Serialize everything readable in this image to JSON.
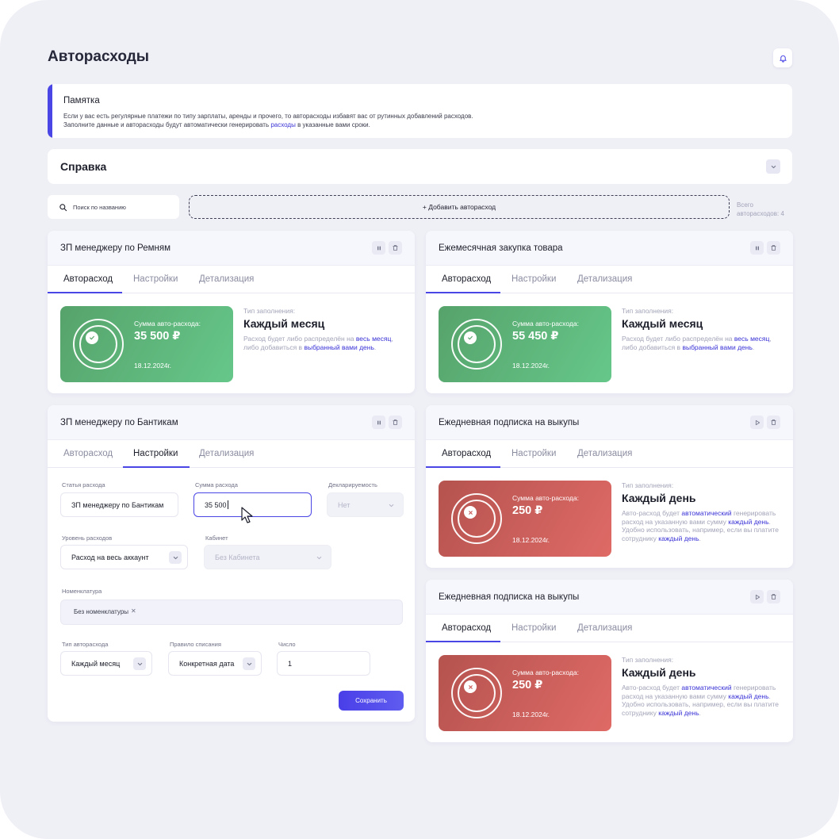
{
  "page": {
    "title": "Авторасходы"
  },
  "memo": {
    "title": "Памятка",
    "text_1": "Если у вас есть регулярные платежи по типу зарплаты, аренды и прочего, то авторасходы избавят вас от рутинных добавлений расходов. Заполните данные и авторасходы будут автоматически генерировать ",
    "link": "расходы",
    "text_2": " в указанные вами сроки."
  },
  "help": {
    "title": "Справка"
  },
  "search": {
    "placeholder": "Поиск по названию"
  },
  "add_button": "+ Добавить авторасход",
  "total": {
    "line_1": "Всего",
    "line_2": "авторасходов: 4"
  },
  "tabs": [
    "Авторасход",
    "Настройки",
    "Детализация"
  ],
  "cards": [
    {
      "title": "ЗП менеджеру по Ремням",
      "sum_label": "Сумма авто-расхода:",
      "sum_value": "35 500 ₽",
      "date": "18.12.2024г.",
      "fill_label": "Тип заполнения:",
      "fill_type": "Каждый месяц",
      "desc_1": "Расход будет либо распределён на ",
      "desc_link_1": "весь месяц",
      "desc_2": ", либо добавиться в ",
      "desc_link_2": "выбранный вами день",
      "desc_3": "."
    },
    {
      "title": "Ежемесячная закупка товара",
      "sum_label": "Сумма авто-расхода:",
      "sum_value": "55 450 ₽",
      "date": "18.12.2024г.",
      "fill_label": "Тип заполнения:",
      "fill_type": "Каждый месяц",
      "desc_1": "Расход будет либо распределён на ",
      "desc_link_1": "весь месяц",
      "desc_2": ", либо добавиться в ",
      "desc_link_2": "выбранный вами день",
      "desc_3": "."
    },
    {
      "title": "ЗП менеджеру по Бантикам",
      "form": {
        "article_label": "Статья расхода",
        "article_value": "ЗП менеджеру по Бантикам",
        "sum_label": "Сумма расхода",
        "sum_value": "35 500",
        "declared_label": "Декларируемость",
        "declared_value": "Нет",
        "level_label": "Уровень расходов",
        "level_value": "Расход на весь аккаунт",
        "cabinet_label": "Кабинет",
        "cabinet_value": "Без Кабинета",
        "nomenclature_label": "Номенклатура",
        "nomenclature_chip": "Без номенклатуры",
        "type_label": "Тип авторасхода",
        "type_value": "Каждый месяц",
        "rule_label": "Правило списания",
        "rule_value": "Конкретная дата",
        "number_label": "Число",
        "number_value": "1",
        "save": "Сохранить"
      }
    },
    {
      "title": "Ежедневная подписка на выкупы",
      "sum_label": "Сумма авто-расхода:",
      "sum_value": "250 ₽",
      "date": "18.12.2024г.",
      "fill_label": "Тип заполнения:",
      "fill_type": "Каждый день",
      "desc_1": "Авто-расход будет ",
      "desc_link_1": "автоматический",
      "desc_2": " генерировать расход на указанную вами сумму ",
      "desc_link_2": "каждый день",
      "desc_3": ". Удобно использовать, например, если вы платите сотруднику ",
      "desc_link_3": "каждый день",
      "desc_4": "."
    },
    {
      "title": "Ежедневная подписка на выкупы",
      "sum_label": "Сумма авто-расхода:",
      "sum_value": "250 ₽",
      "date": "18.12.2024г.",
      "fill_label": "Тип заполнения:",
      "fill_type": "Каждый день",
      "desc_1": "Авто-расход будет ",
      "desc_link_1": "автоматический",
      "desc_2": " генерировать расход на указанную вами сумму ",
      "desc_link_2": "каждый день",
      "desc_3": ". Удобно использовать, например, если вы платите сотруднику ",
      "desc_link_3": "каждый день",
      "desc_4": "."
    }
  ],
  "colors": {
    "accent": "#4a46e6",
    "green": "#5cb377",
    "red": "#c95a56",
    "background": "#efeff6"
  }
}
